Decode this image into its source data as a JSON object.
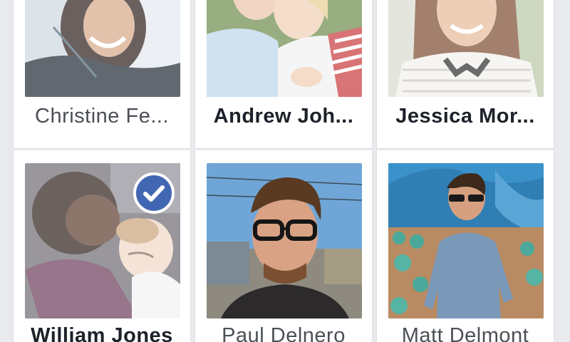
{
  "friends": [
    {
      "name": "Christine Fe...",
      "selected": false
    },
    {
      "name": "Andrew Joh...",
      "selected": false
    },
    {
      "name": "Jessica Mor...",
      "selected": false
    },
    {
      "name": "William Jones",
      "selected": true
    },
    {
      "name": "Paul Delnero",
      "selected": false
    },
    {
      "name": "Matt Delmont",
      "selected": false
    }
  ],
  "colors": {
    "accent": "#4267b2",
    "background": "#e9eaed",
    "card": "#ffffff",
    "text_dark": "#1d2129",
    "text_regular": "#4b4f56"
  }
}
